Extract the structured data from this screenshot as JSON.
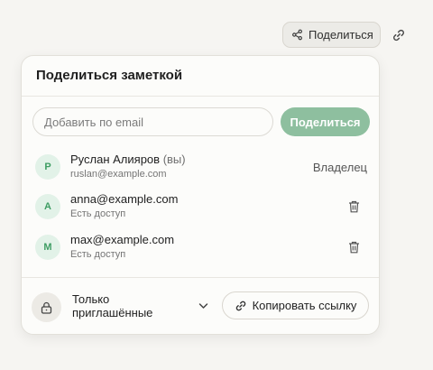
{
  "toolbar": {
    "share_label": "Поделиться",
    "share_icon": "share-icon",
    "link_icon": "link-icon"
  },
  "panel": {
    "title": "Поделиться заметкой",
    "email_placeholder": "Добавить по email",
    "email_value": "",
    "share_button": "Поделиться"
  },
  "members": [
    {
      "initial": "Р",
      "name": "Руслан Алияров",
      "you_tag": "(вы)",
      "subtitle": "ruslan@example.com",
      "role": "Владелец"
    },
    {
      "initial": "A",
      "name": "anna@example.com",
      "subtitle": "Есть доступ",
      "action_icon": "trash-icon"
    },
    {
      "initial": "M",
      "name": "max@example.com",
      "subtitle": "Есть доступ",
      "action_icon": "trash-icon"
    }
  ],
  "access": {
    "icon": "lock-icon",
    "label": "Только приглашённые",
    "chevron_icon": "chevron-down-icon"
  },
  "copy_link_button": "Копировать ссылку",
  "colors": {
    "accent": "#8ebf9f",
    "avatar_bg": "#e2f2e8",
    "avatar_text": "#3e9d63",
    "background": "#f6f5f2"
  }
}
